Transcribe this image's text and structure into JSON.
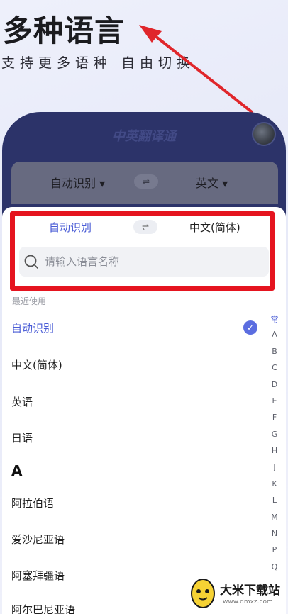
{
  "headline": "多种语言",
  "subline": "支持更多语种 自由切换",
  "phone": {
    "title": "中英翻译通",
    "top_left_lang": "自动识别 ▾",
    "top_right_lang": "英文 ▾",
    "swap_glyph": "⇌"
  },
  "sheet": {
    "source_lang": "自动识别",
    "target_lang": "中文(简体)",
    "swap_glyph": "⇌",
    "search_placeholder": "请输入语言名称",
    "section_label": "最近使用",
    "recent": [
      "自动识别",
      "中文(简体)",
      "英语",
      "日语"
    ],
    "selected": "自动识别",
    "letter_a": "A",
    "a_items": [
      "阿拉伯语",
      "爱沙尼亚语",
      "阿塞拜疆语",
      "阿尔巴尼亚语"
    ],
    "check_glyph": "✓",
    "index": [
      "常",
      "A",
      "B",
      "C",
      "D",
      "E",
      "F",
      "G",
      "H",
      "J",
      "K",
      "L",
      "M",
      "N",
      "P",
      "Q"
    ]
  },
  "watermark": {
    "title": "大米下载站",
    "url": "www.dmxz.com"
  },
  "colors": {
    "accent": "#4a5cd6",
    "phone_bg": "#2c3369",
    "highlight_frame": "#e5141f",
    "arrow": "#e0262b"
  }
}
